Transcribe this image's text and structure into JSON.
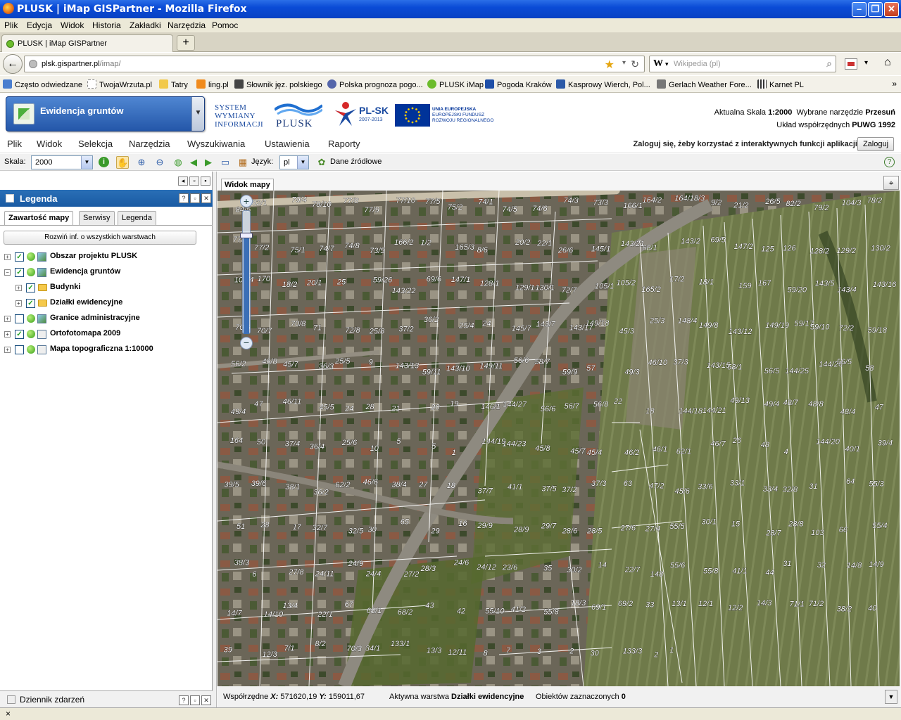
{
  "window": {
    "title": "PLUSK | iMap GISPartner - Mozilla Firefox",
    "minimize": "–",
    "maximize": "❐",
    "close": "✕"
  },
  "browser_menu": [
    "Plik",
    "Edycja",
    "Widok",
    "Historia",
    "Zakładki",
    "Narzędzia",
    "Pomoc"
  ],
  "tab": {
    "label": "PLUSK | iMap GISPartner",
    "new_tab": "+"
  },
  "nav": {
    "back": "←",
    "url_host": "plsk.gispartner.pl",
    "url_path": "/imap/",
    "search_engine": "W",
    "search_placeholder": "Wikipedia (pl)",
    "star": "★",
    "reload": "↻",
    "dropdown": "▾",
    "search_icon": "search-icon"
  },
  "bookmarks": [
    {
      "label": "Często odwiedzane",
      "color": "#4a7ecf"
    },
    {
      "label": "TwojaWrzuta.pl",
      "color": "#ffffff"
    },
    {
      "label": "Tatry",
      "color": "#f2c94b"
    },
    {
      "label": "ling.pl",
      "color": "#f08a1c"
    },
    {
      "label": "Słownik jęz. polskiego",
      "color": "#444444"
    },
    {
      "label": "Polska prognoza pogo...",
      "color": "#5566aa"
    },
    {
      "label": "PLUSK iMap",
      "color": "#6cbc2c"
    },
    {
      "label": "Pogoda Kraków",
      "color": "#1f4fa8"
    },
    {
      "label": "Kasprowy Wierch, Pol...",
      "color": "#2c5aa8"
    },
    {
      "label": "Gerlach Weather Fore...",
      "color": "#777777"
    },
    {
      "label": "Karnet PL",
      "color": "#333333"
    }
  ],
  "bookmarks_more": "»",
  "app_header": {
    "module": "Ewidencja gruntów",
    "module_arrow": "▼",
    "swi_lines": [
      "SYSTEM",
      "WYMIANY",
      "INFORMACJI"
    ],
    "plusk_name": "PLUSK",
    "plsk_text": "PL-SK",
    "plsk_years": "2007-2013",
    "eu_lines": [
      "UNIA EUROPEJSKA",
      "EUROPEJSKI FUNDUSZ",
      "ROZWOJU REGIONALNEGO"
    ],
    "scale_label": "Aktualna Skala",
    "scale_value": "1:2000",
    "tool_label": "Wybrane narzędzie",
    "tool_value": "Przesuń",
    "crs_label": "Układ współrzędnych",
    "crs_value": "PUWG 1992"
  },
  "app_menu": [
    "Plik",
    "Widok",
    "Selekcja",
    "Narzędzia",
    "Wyszukiwania",
    "Ustawienia",
    "Raporty"
  ],
  "login": {
    "message": "Zaloguj się, żeby korzystać z interaktywnych funkcji aplikacji",
    "button": "Zaloguj"
  },
  "toolbar": {
    "scale_label": "Skala:",
    "scale_value": "2000",
    "lang_label": "Język:",
    "lang_value": "pl",
    "sources_label": "Dane źródłowe",
    "help": "?"
  },
  "legend": {
    "title": "Legenda",
    "tabs": [
      "Zawartość mapy",
      "Serwisy",
      "Legenda"
    ],
    "info_all_button": "Rozwiń inf. o wszystkich warstwach",
    "layers": [
      {
        "label": "Obszar projektu PLUSK",
        "checked": true,
        "expand": "+",
        "indent": 0,
        "kind": "layer"
      },
      {
        "label": "Ewidencja gruntów",
        "checked": true,
        "expand": "−",
        "indent": 0,
        "kind": "layer"
      },
      {
        "label": "Budynki",
        "checked": true,
        "expand": "+",
        "indent": 1,
        "kind": "folder"
      },
      {
        "label": "Działki ewidencyjne",
        "checked": true,
        "expand": "+",
        "indent": 1,
        "kind": "folder"
      },
      {
        "label": "Granice administracyjne",
        "checked": false,
        "expand": "+",
        "indent": 0,
        "kind": "layer"
      },
      {
        "label": "Ortofotomapa 2009",
        "checked": true,
        "expand": "+",
        "indent": 0,
        "kind": "raster"
      },
      {
        "label": "Mapa topograficzna 1:10000",
        "checked": false,
        "expand": "+",
        "indent": 0,
        "kind": "raster"
      }
    ],
    "check_mark": "✓",
    "events_title": "Dziennik zdarzeń"
  },
  "map": {
    "tab": "Widok mapy",
    "zoom_in": "+",
    "zoom_out": "−",
    "zoom_level": 0.82,
    "parcel_labels": [
      "84/5",
      "82/1",
      "79/4",
      "78/10",
      "77/8",
      "77/9",
      "77/10",
      "77/5",
      "75/2",
      "74/1",
      "74/5",
      "74/6",
      "74/3",
      "73/3",
      "166/1",
      "164/2",
      "164/18/3",
      "9/2",
      "21/2",
      "26/5",
      "82/2",
      "79/2",
      "104/3",
      "78/2",
      "77/4",
      "77/2",
      "75/1",
      "74/7",
      "74/8",
      "73/5",
      "166/2",
      "1/2",
      "165/3",
      "8/6",
      "20/2",
      "22/1",
      "26/6",
      "145/1",
      "143/21",
      "68/1",
      "143/2",
      "69/5",
      "147/2",
      "125",
      "126",
      "128/2",
      "129/2",
      "130/2",
      "104/4",
      "170",
      "18/2",
      "20/1",
      "25",
      "59/26",
      "143/22",
      "69/6",
      "147/1",
      "128/1",
      "129/1",
      "130/1",
      "72/7",
      "105/1",
      "105/2",
      "165/2",
      "17/2",
      "18/1",
      "159",
      "167",
      "59/20",
      "143/5",
      "143/4",
      "143/16",
      "70/6",
      "70/7",
      "70/8",
      "71",
      "72/8",
      "25/8",
      "37/2",
      "36/2",
      "25/4",
      "24",
      "145/7",
      "143/7",
      "143/17",
      "149/18",
      "45/3",
      "25/3",
      "148/4",
      "149/8",
      "143/12",
      "149/19",
      "59/17",
      "59/10",
      "72/2",
      "59/18",
      "56/2",
      "46/8",
      "45/7",
      "36/3",
      "25/5",
      "9",
      "143/13",
      "59/11",
      "143/10",
      "149/11",
      "56/6",
      "58/7",
      "59/9",
      "57",
      "49/3",
      "46/10",
      "37/3",
      "143/15",
      "58/1",
      "56/5",
      "144/25",
      "144/26",
      "56/5",
      "58",
      "49/4",
      "47",
      "46/11",
      "45/5",
      "24",
      "28",
      "21",
      "20",
      "19",
      "146/1",
      "144/27",
      "56/6",
      "56/7",
      "56/8",
      "22",
      "18",
      "144/18",
      "144/21",
      "49/13",
      "49/4",
      "48/7",
      "48/8",
      "48/4",
      "47",
      "164",
      "50",
      "37/4",
      "36/4",
      "25/6",
      "10",
      "5",
      "5",
      "1",
      "144/19",
      "144/23",
      "45/8",
      "45/7",
      "45/4",
      "46/2",
      "46/1",
      "62/1",
      "46/7",
      "26",
      "48",
      "4",
      "144/20",
      "40/1",
      "39/4",
      "39/5",
      "39/6",
      "38/1",
      "36/2",
      "62/2",
      "46/6",
      "38/4",
      "27",
      "18",
      "37/7",
      "41/1",
      "37/5",
      "37/2",
      "37/3",
      "63",
      "47/2",
      "45/6",
      "33/6",
      "33/1",
      "33/4",
      "32/8",
      "31",
      "64",
      "55/3",
      "51",
      "28",
      "17",
      "32/7",
      "32/5",
      "30",
      "65",
      "29",
      "16",
      "29/9",
      "28/9",
      "29/7",
      "28/6",
      "28/5",
      "27/6",
      "27/4",
      "55/5",
      "30/1",
      "15",
      "28/7",
      "28/8",
      "103",
      "66",
      "55/4",
      "38/3",
      "6",
      "27/8",
      "24/11",
      "24/9",
      "24/4",
      "27/2",
      "28/3",
      "24/6",
      "24/12",
      "23/6",
      "35",
      "30/2",
      "14",
      "22/7",
      "148",
      "55/6",
      "55/8",
      "41/1",
      "44",
      "31",
      "32",
      "14/8",
      "14/9",
      "14/7",
      "14/10",
      "13/4",
      "22/1",
      "67",
      "68/1",
      "68/2",
      "43",
      "42",
      "55/10",
      "41/2",
      "55/8",
      "18/3",
      "69/1",
      "69/2",
      "33",
      "13/1",
      "12/1",
      "12/2",
      "14/3",
      "71/1",
      "71/2",
      "38/2",
      "40",
      "39",
      "12/3",
      "7/1",
      "8/2",
      "70/3",
      "34/1",
      "133/1",
      "13/3",
      "12/11",
      "8",
      "7",
      "3",
      "2",
      "30",
      "133/3",
      "2",
      "1"
    ]
  },
  "status": {
    "coords_label": "Współrzędne",
    "x_label": "X:",
    "x_value": "571620,19",
    "y_label": "Y:",
    "y_value": "159011,67",
    "layer_label": "Aktywna warstwa",
    "layer_value": "Działki ewidencyjne",
    "selected_label": "Obiektów zaznaczonych",
    "selected_value": "0"
  },
  "ff_status": {
    "close": "×"
  }
}
